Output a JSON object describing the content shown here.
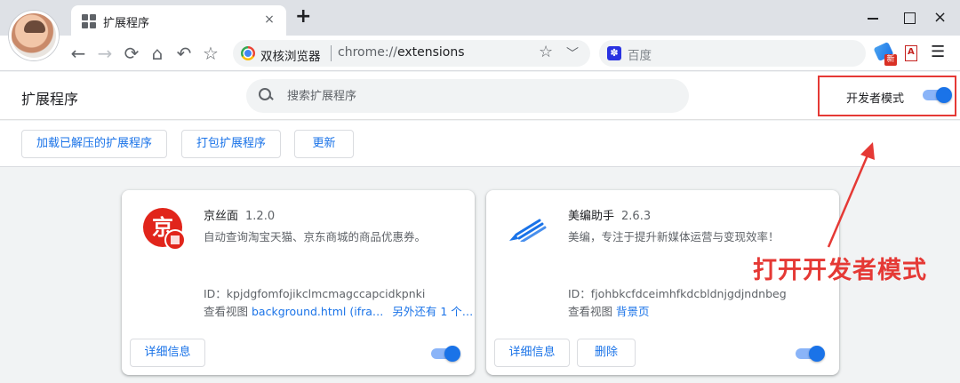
{
  "browser": {
    "tab_title": "扩展程序",
    "tab_close": "×",
    "new_tab": "+",
    "window_close": "×",
    "browser_name": "双核浏览器",
    "url_scheme": "chrome://",
    "url_path": "extensions",
    "search_engine": "百度",
    "new_badge": "新",
    "menu": "☰"
  },
  "header": {
    "title": "扩展程序",
    "search_placeholder": "搜索扩展程序",
    "developer_mode_label": "开发者模式",
    "developer_mode_on": true
  },
  "actions": {
    "load_unpacked": "加载已解压的扩展程序",
    "pack": "打包扩展程序",
    "update": "更新"
  },
  "extensions": [
    {
      "icon": "jd-logo",
      "logo_char": "京",
      "name": "京丝面",
      "version": "1.2.0",
      "description": "自动查询淘宝天猫、京东商城的商品优惠券。",
      "id_line": "ID：kpjdgfomfojikclmcmagccapcidkpnki",
      "views_label": "查看视图",
      "views_link1": "background.html (ifra…",
      "views_link2": "另外还有 1 个…",
      "details_label": "详细信息",
      "enabled": true
    },
    {
      "icon": "pen-icon",
      "name": "美编助手",
      "version": "2.6.3",
      "description": "美编，专注于提升新媒体运营与变现效率！",
      "id_line": "ID：fjohbkcfdceimhfkdcbldnjgdjndnbeg",
      "views_label": "查看视图",
      "views_link1": "背景页",
      "details_label": "详细信息",
      "remove_label": "删除",
      "enabled": true
    }
  ],
  "annotation": {
    "text": "打开开发者模式",
    "color": "#e53935"
  },
  "colors": {
    "accent": "#1a73e8",
    "toggle_track": "#8ab4f8",
    "page_bg": "#f1f3f4"
  }
}
